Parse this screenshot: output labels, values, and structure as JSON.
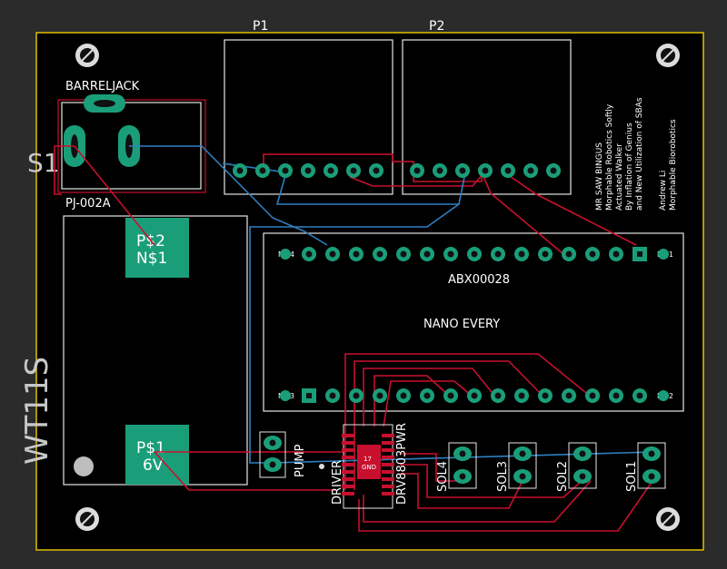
{
  "board": {
    "bg": "#2b2b2b",
    "pcb": "#000000",
    "edge": "#e0c000",
    "copper_top": "#c8102e",
    "copper_bottom": "#2f7fc1",
    "pad": "#1a9e7a",
    "silk": "#ffffff"
  },
  "labels": {
    "p1": "P1",
    "p2": "P2",
    "barreljack": "BARRELJACK",
    "s1": "S1",
    "pj002a": "PJ-002A",
    "ps2": "P$2",
    "ns1": "N$1",
    "ps1": "P$1",
    "six_v": "6V",
    "wt11s": "WT11S",
    "abx": "ABX00028",
    "nano": "NANO EVERY",
    "mh1": "MH1",
    "mh2": "MH2",
    "mh3": "MH3",
    "mh4": "MH4",
    "pump": "PUMP",
    "driver": "DRIVER",
    "drv": "DRV8803PWR",
    "chip_num": "17",
    "chip_gnd": "GND",
    "sol1": "SOL1",
    "sol2": "SOL2",
    "sol3": "SOL3",
    "sol4": "SOL4"
  },
  "notes": [
    "MR SAW BINGUS",
    "Morphable Robotics Softly",
    "Actuated Walker",
    "By Inflation of Genius",
    "and New Utilization of SBAs",
    "Andrew Li",
    "Morphable Biorobotics"
  ]
}
